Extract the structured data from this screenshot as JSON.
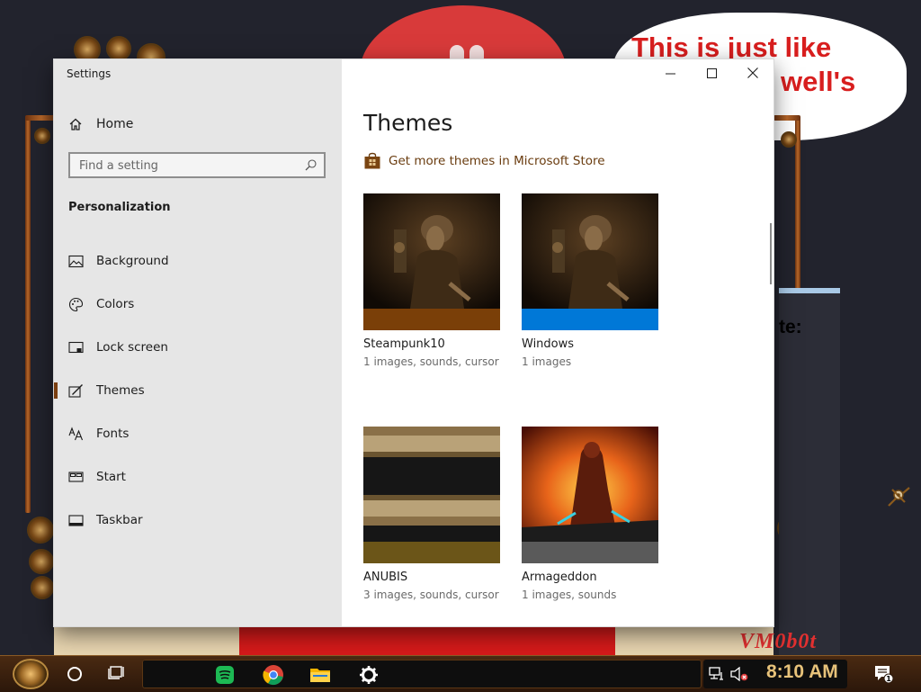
{
  "desktop": {
    "bubble_line1": "This is just like",
    "bubble_line2": "well's",
    "panel_fragment": "te:",
    "watermark": "VM0b0t"
  },
  "window": {
    "title": "Settings",
    "controls": {
      "minimize_icon": "minimize-icon",
      "maximize_icon": "maximize-icon",
      "close_icon": "close-icon"
    }
  },
  "sidebar": {
    "home_label": "Home",
    "search_placeholder": "Find a setting",
    "section_title": "Personalization",
    "items": [
      {
        "label": "Background",
        "icon": "picture-icon",
        "active": false
      },
      {
        "label": "Colors",
        "icon": "palette-icon",
        "active": false
      },
      {
        "label": "Lock screen",
        "icon": "lock-screen-icon",
        "active": false
      },
      {
        "label": "Themes",
        "icon": "brush-icon",
        "active": true
      },
      {
        "label": "Fonts",
        "icon": "fonts-icon",
        "active": false
      },
      {
        "label": "Start",
        "icon": "start-icon",
        "active": false
      },
      {
        "label": "Taskbar",
        "icon": "taskbar-icon",
        "active": false
      }
    ]
  },
  "main": {
    "title": "Themes",
    "store_link": "Get more themes in Microsoft Store",
    "themes": [
      {
        "name": "Steampunk10",
        "details": "1 images, sounds, cursor",
        "accent": "#7a3f08"
      },
      {
        "name": "Windows",
        "details": "1 images",
        "accent": "#0078d7"
      },
      {
        "name": "ANUBIS",
        "details": "3 images, sounds, cursor",
        "accent": "#6b5518"
      },
      {
        "name": "Armageddon",
        "details": "1 images, sounds",
        "accent": "#5a5a5a"
      }
    ]
  },
  "taskbar": {
    "clock": "8:10 AM",
    "apps": [
      "spotify-icon",
      "chrome-icon",
      "file-explorer-icon",
      "settings-gear-icon"
    ],
    "tray": [
      "network-icon",
      "volume-muted-icon",
      "notification-icon"
    ],
    "notification_count": "1"
  },
  "colors": {
    "sidebar_bg": "#e6e6e6",
    "link_brown": "#6a3c0f",
    "active_marker": "#7a3e10",
    "clock_gold": "#e7c27a"
  }
}
